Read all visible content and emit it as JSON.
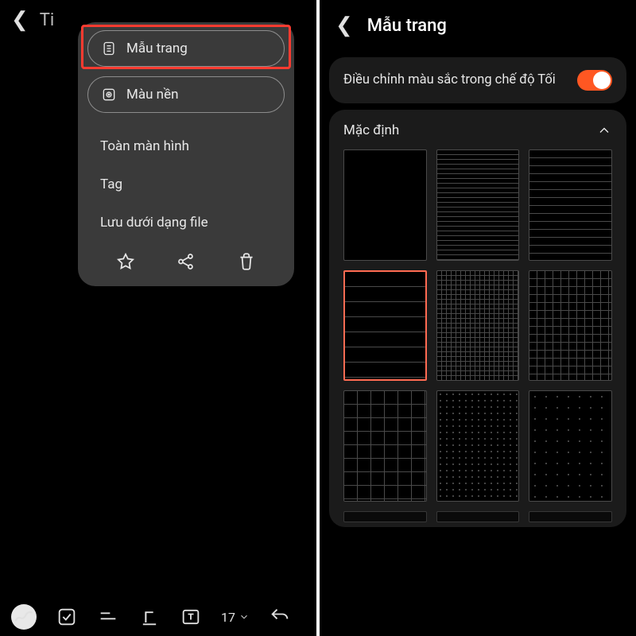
{
  "left": {
    "header_title": "Ti",
    "popup": {
      "page_template_label": "Mẫu trang",
      "background_color_label": "Màu nền",
      "menu": {
        "fullscreen": "Toàn màn hình",
        "tag": "Tag",
        "save_as_file": "Lưu dưới dạng file"
      }
    },
    "toolbar": {
      "font_size": "17"
    }
  },
  "right": {
    "title": "Mẫu trang",
    "dark_adjust_label": "Điều chỉnh màu sắc trong chế độ Tối",
    "dark_adjust_on": true,
    "group_default_label": "Mặc định",
    "templates": [
      {
        "id": "blank",
        "pattern": "p-blank",
        "selected": false
      },
      {
        "id": "hlines-tight",
        "pattern": "p-hlines-tight",
        "selected": false
      },
      {
        "id": "hlines-med",
        "pattern": "p-hlines-med",
        "selected": false
      },
      {
        "id": "hlines-wide",
        "pattern": "p-hlines-wide",
        "selected": true
      },
      {
        "id": "grid-tight",
        "pattern": "p-grid-tight",
        "selected": false
      },
      {
        "id": "grid-med",
        "pattern": "p-grid-med",
        "selected": false
      },
      {
        "id": "grid-wide",
        "pattern": "p-grid-wide",
        "selected": false
      },
      {
        "id": "dots-tight",
        "pattern": "p-dots-tight",
        "selected": false
      },
      {
        "id": "dots-med",
        "pattern": "p-dots-med",
        "selected": false
      }
    ]
  },
  "colors": {
    "accent": "#ff5722",
    "highlight": "#ff3b30",
    "selected_border": "#ff6b52"
  }
}
